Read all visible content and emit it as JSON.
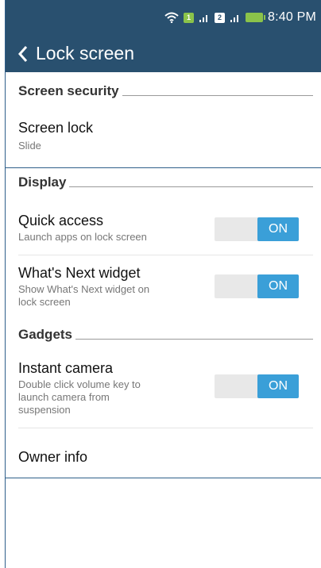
{
  "status_bar": {
    "wifi_icon": "wifi-icon",
    "sim1_label": "1",
    "sim2_label": "2",
    "signal_icon": "signal-bars-icon",
    "battery_icon": "battery-charging-icon",
    "time": "8:40 PM"
  },
  "app_bar": {
    "back_icon": "chevron-left-icon",
    "title": "Lock screen"
  },
  "sections": {
    "screen_security": {
      "title": "Screen security",
      "screen_lock": {
        "title": "Screen lock",
        "subtitle": "Slide"
      }
    },
    "display": {
      "title": "Display",
      "quick_access": {
        "title": "Quick access",
        "subtitle": "Launch apps on lock screen",
        "toggle": "ON"
      },
      "whats_next": {
        "title": "What's Next widget",
        "subtitle_line1": "Show What's Next widget on",
        "subtitle_line2": "lock screen",
        "toggle": "ON"
      }
    },
    "gadgets": {
      "title": "Gadgets",
      "instant_camera": {
        "title": "Instant camera",
        "subtitle_line1": "Double click volume key to",
        "subtitle_line2": "launch camera from",
        "subtitle_line3": "suspension",
        "toggle": "ON"
      },
      "owner_info": {
        "title": "Owner info"
      }
    }
  },
  "colors": {
    "app_bar": "#29506f",
    "toggle_on": "#3a9fd8",
    "toggle_off_track": "#e8e8e8",
    "sim_green": "#8bc34a"
  }
}
